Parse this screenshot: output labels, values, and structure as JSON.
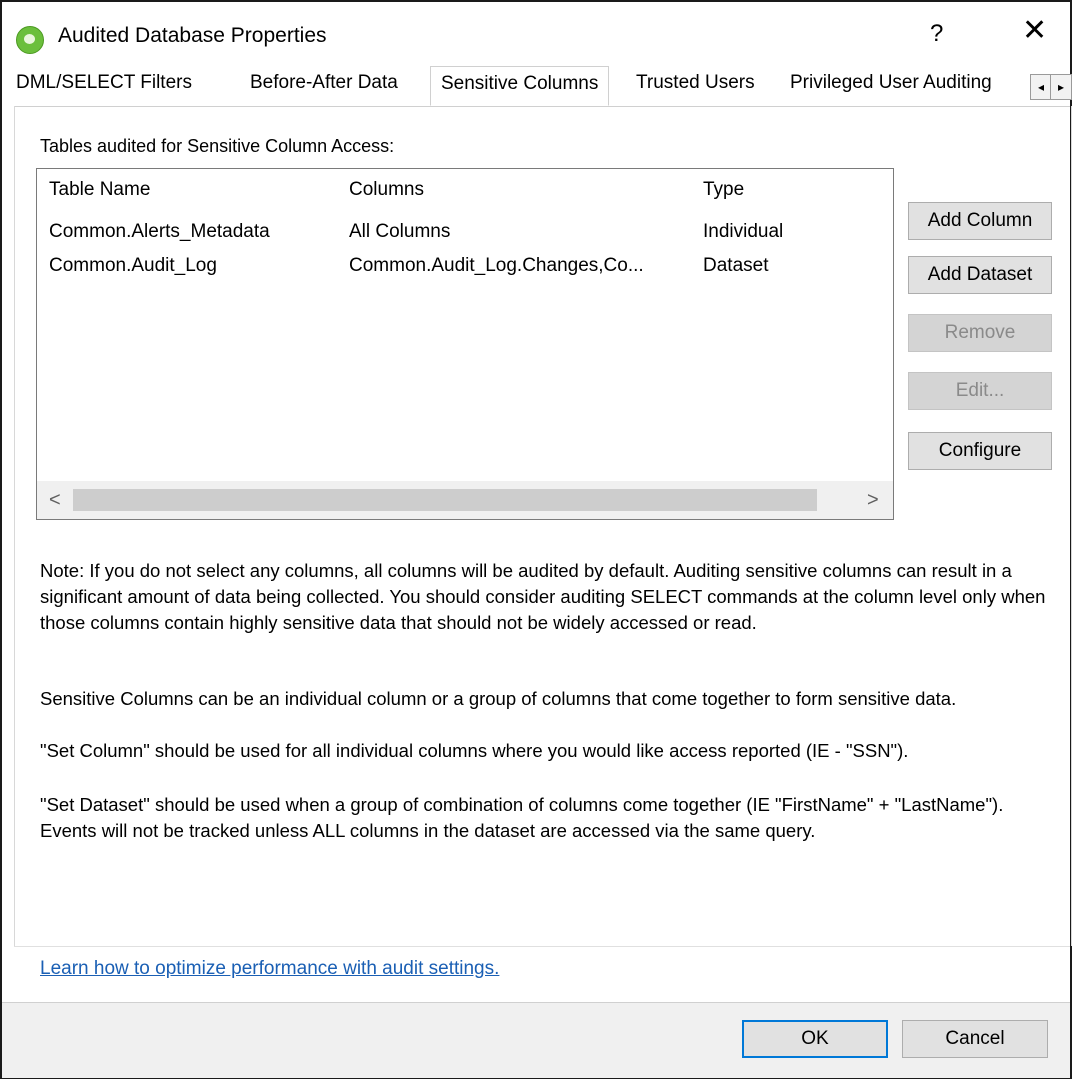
{
  "window": {
    "title": "Audited Database Properties",
    "help": "?",
    "close": "✕"
  },
  "tabs": [
    {
      "label": "DML/SELECT Filters"
    },
    {
      "label": "Before-After Data"
    },
    {
      "label": "Sensitive Columns",
      "active": true
    },
    {
      "label": "Trusted Users"
    },
    {
      "label": "Privileged User Auditing"
    }
  ],
  "tab_scroll": {
    "left": "◂",
    "right": "▸"
  },
  "section_label": "Tables audited for Sensitive Column Access:",
  "table": {
    "headers": [
      "Table Name",
      "Columns",
      "Type"
    ],
    "rows": [
      [
        "Common.Alerts_Metadata",
        "All Columns",
        "Individual"
      ],
      [
        "Common.Audit_Log",
        "Common.Audit_Log.Changes,Co...",
        "Dataset"
      ]
    ],
    "scroll_left": "<",
    "scroll_right": ">"
  },
  "buttons": {
    "add_column": "Add Column",
    "add_dataset": "Add Dataset",
    "remove": "Remove",
    "edit": "Edit...",
    "configure": "Configure"
  },
  "notes": {
    "p1": "Note: If you do not select any columns, all columns will be audited by default. Auditing sensitive columns can result in a significant amount of data being collected.  You should consider auditing SELECT commands at the column level only when those columns contain highly sensitive data that should not be widely accessed or read.",
    "p2": "Sensitive Columns can be an individual column or a group of columns that come together to form sensitive data.",
    "p3": "\"Set Column\" should be used for all individual columns where you would like access reported (IE - \"SSN\").",
    "p4": "\"Set Dataset\" should be used when a group of combination of columns come together (IE \"FirstName\" + \"LastName\"). Events will not be tracked unless ALL columns in the dataset are accessed via the same query."
  },
  "link": "Learn how to optimize performance with audit settings.",
  "dialog_buttons": {
    "ok": "OK",
    "cancel": "Cancel"
  }
}
